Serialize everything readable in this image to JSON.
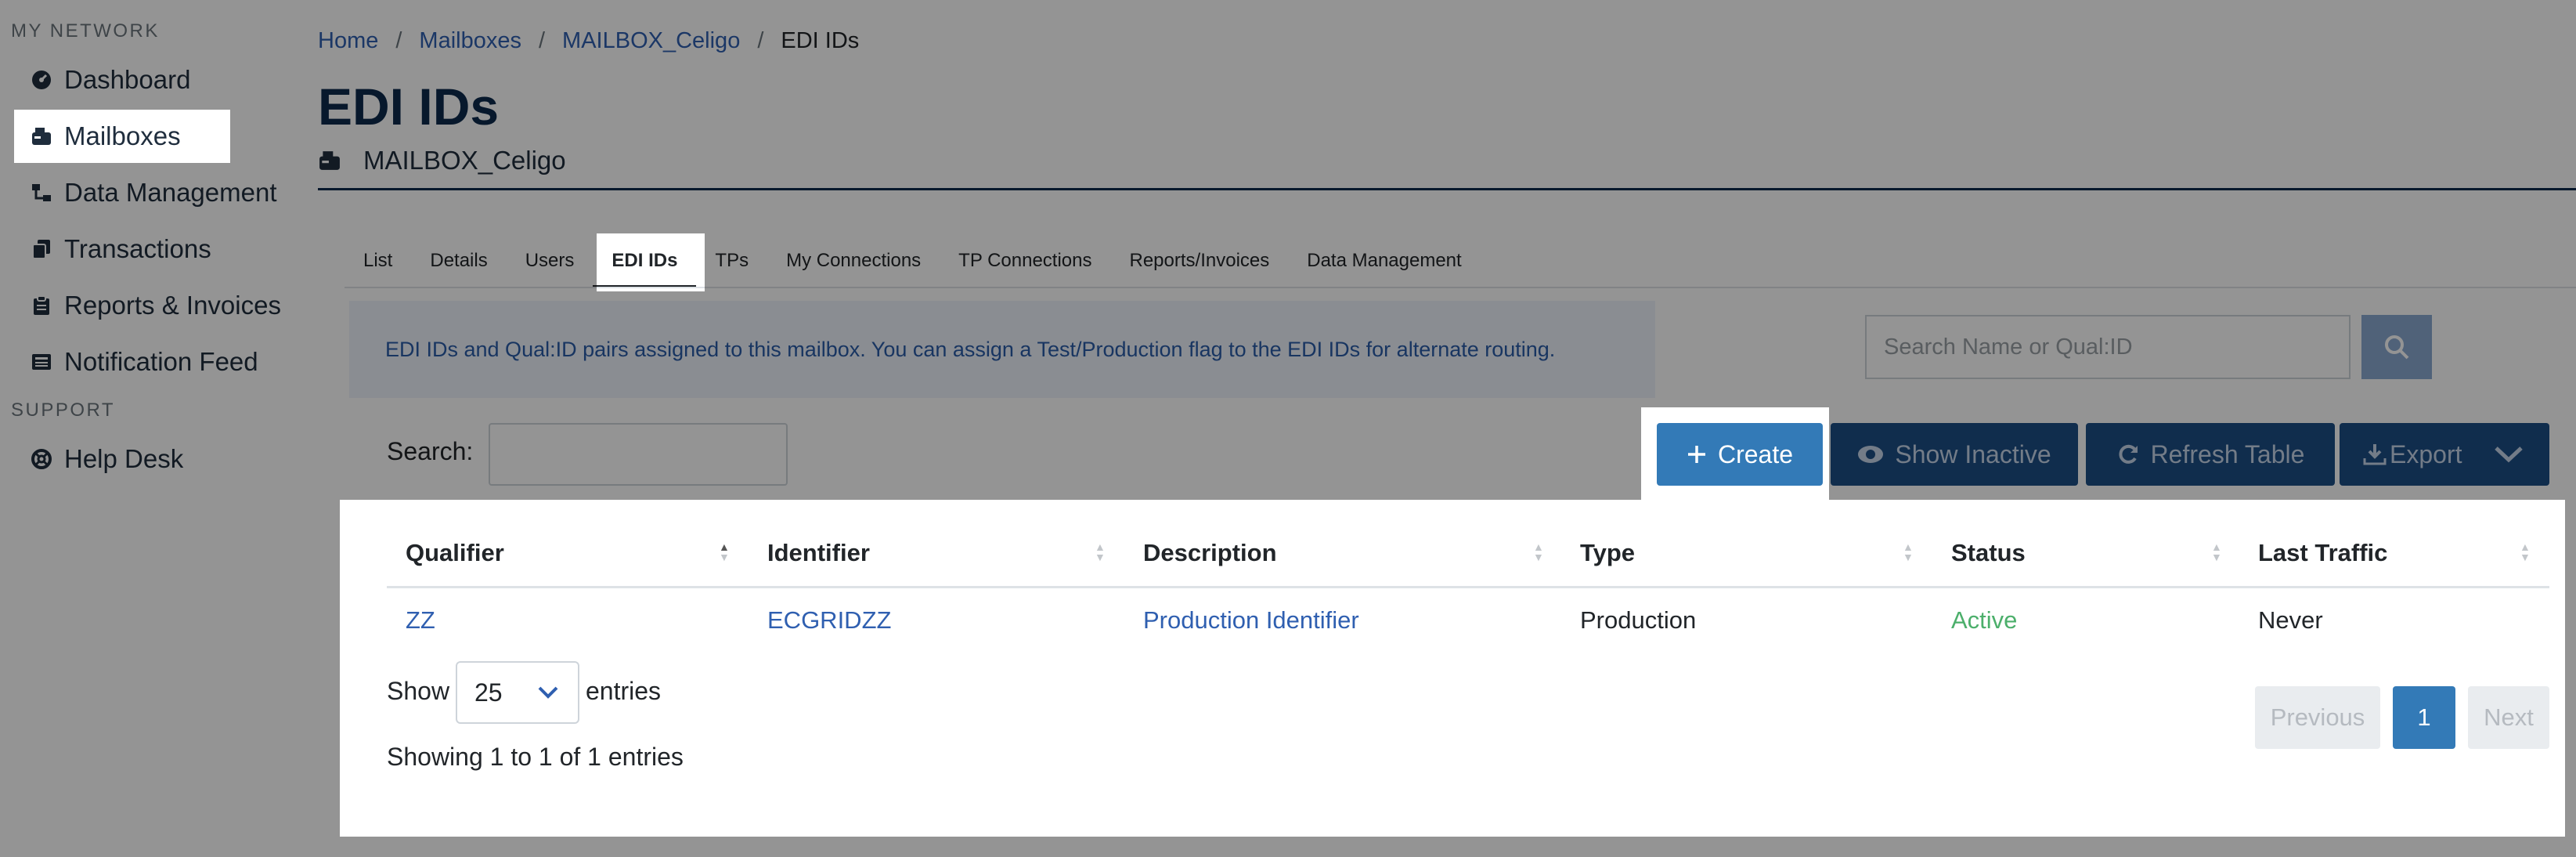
{
  "sidebar": {
    "network_heading": "MY NETWORK",
    "items": [
      {
        "label": "Dashboard",
        "icon": "gauge-icon"
      },
      {
        "label": "Mailboxes",
        "icon": "mailbox-icon"
      },
      {
        "label": "Data Management",
        "icon": "sitemap-icon"
      },
      {
        "label": "Transactions",
        "icon": "copy-icon"
      },
      {
        "label": "Reports & Invoices",
        "icon": "clipboard-icon"
      },
      {
        "label": "Notification Feed",
        "icon": "newspaper-icon"
      }
    ],
    "support_heading": "SUPPORT",
    "support_items": [
      {
        "label": "Help Desk",
        "icon": "lifering-icon"
      }
    ]
  },
  "breadcrumb": [
    "Home",
    "Mailboxes",
    "MAILBOX_Celigo",
    "EDI IDs"
  ],
  "page": {
    "title": "EDI IDs",
    "subtitle": "MAILBOX_Celigo"
  },
  "tabs": [
    "List",
    "Details",
    "Users",
    "EDI IDs",
    "TPs",
    "My Connections",
    "TP Connections",
    "Reports/Invoices",
    "Data Management"
  ],
  "active_tab": "EDI IDs",
  "info_text": "EDI IDs and Qual:ID pairs assigned to this mailbox. You can assign a Test/Production flag to the EDI IDs for alternate routing.",
  "name_search": {
    "placeholder": "Search Name or Qual:ID"
  },
  "table_search": {
    "label": "Search:",
    "value": ""
  },
  "buttons": {
    "create": "Create",
    "show_inactive": "Show Inactive",
    "refresh": "Refresh Table",
    "export": "Export"
  },
  "table": {
    "columns": [
      "Qualifier",
      "Identifier",
      "Description",
      "Type",
      "Status",
      "Last Traffic"
    ],
    "sorted_column": "Qualifier",
    "rows": [
      {
        "qualifier": "ZZ",
        "identifier": "ECGRIDZZ",
        "description": "Production Identifier",
        "type": "Production",
        "status": "Active",
        "last_traffic": "Never"
      }
    ]
  },
  "length": {
    "show_label": "Show",
    "value": "25",
    "entries_label": "entries"
  },
  "table_info": "Showing 1 to 1 of 1 entries",
  "pagination": {
    "previous": "Previous",
    "current": "1",
    "next": "Next"
  },
  "colors": {
    "primary": "#337ab7",
    "dark_button": "#1d4f86",
    "link": "#2f5fb0",
    "status_active": "#4caf6b",
    "title": "#0d2a4d"
  }
}
